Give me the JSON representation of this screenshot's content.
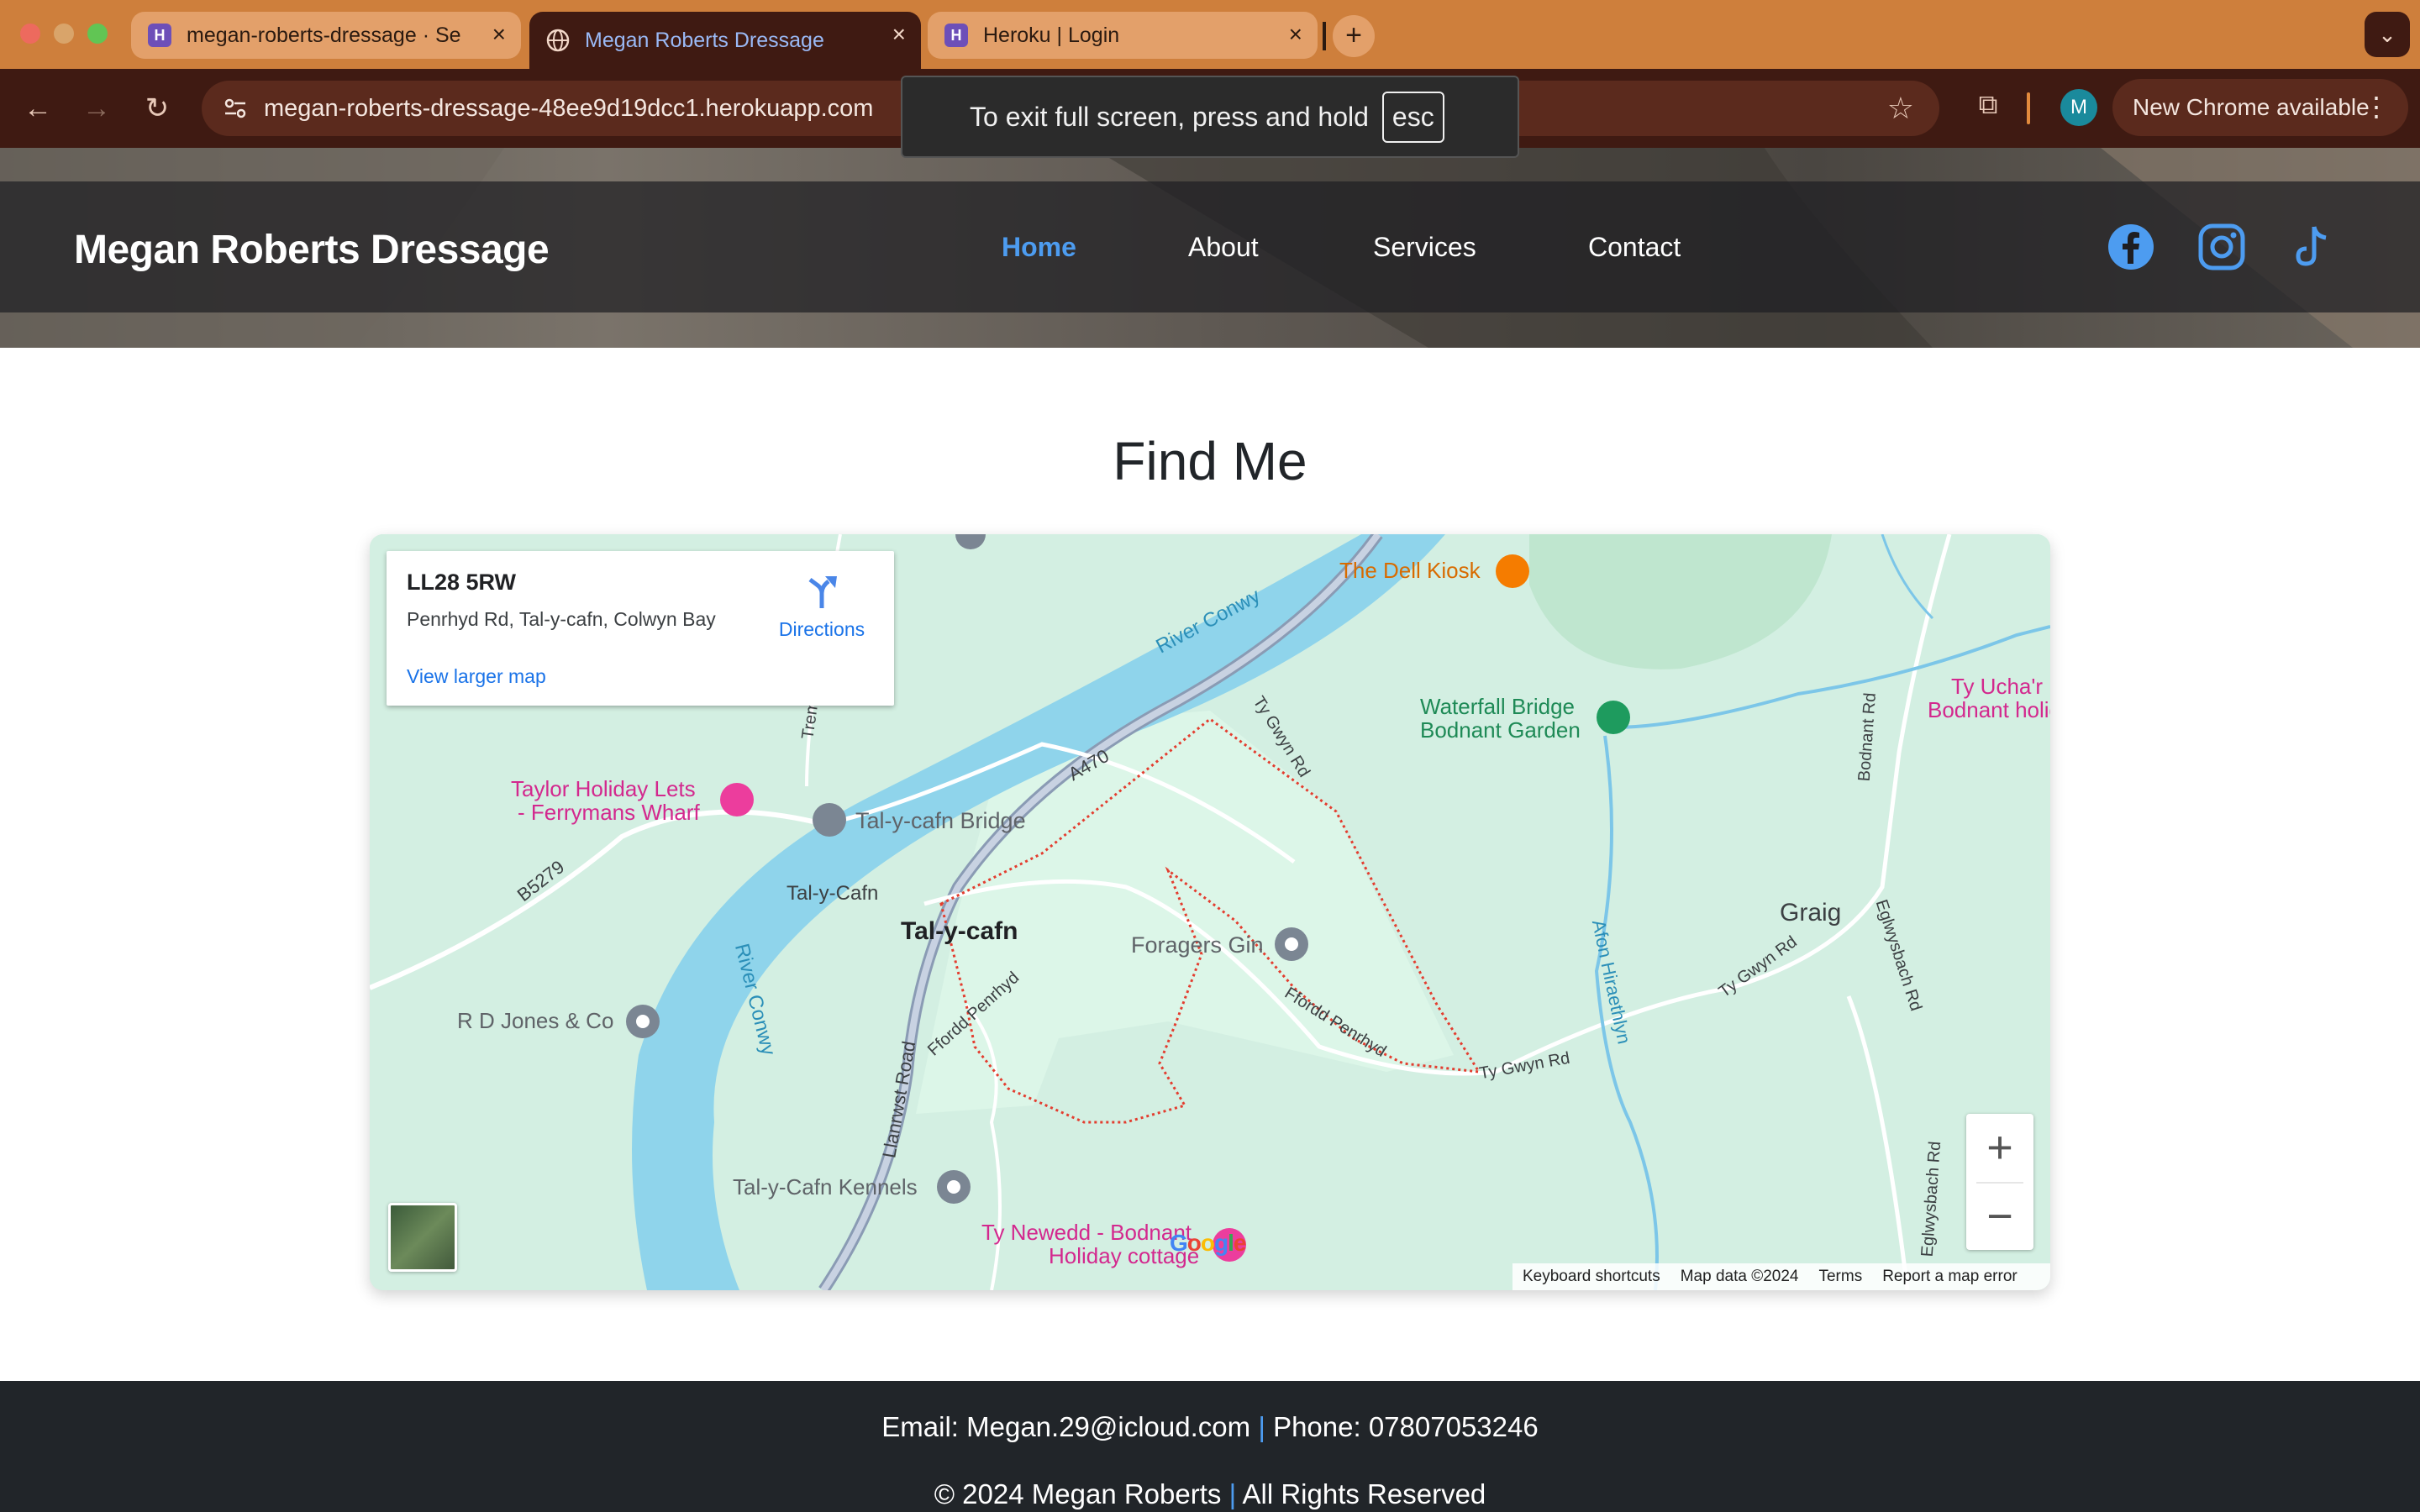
{
  "browser": {
    "tabs": [
      {
        "title": "megan-roberts-dressage · Se",
        "favicon": "heroku-icon"
      },
      {
        "title": "Megan Roberts Dressage",
        "favicon": "globe-icon"
      },
      {
        "title": "Heroku | Login",
        "favicon": "heroku-icon"
      }
    ],
    "url": "megan-roberts-dressage-48ee9d19dcc1.herokuapp.com",
    "profile_initial": "M",
    "update_label": "New Chrome available",
    "fullscreen_notice": "To exit full screen, press and hold",
    "fullscreen_key": "esc"
  },
  "site": {
    "brand": "Megan Roberts Dressage",
    "nav": [
      {
        "label": "Home",
        "active": true
      },
      {
        "label": "About",
        "active": false
      },
      {
        "label": "Services",
        "active": false
      },
      {
        "label": "Contact",
        "active": false
      }
    ],
    "social_icons": [
      "facebook-icon",
      "instagram-icon",
      "tiktok-icon"
    ],
    "section_title": "Find Me"
  },
  "map": {
    "card": {
      "postcode": "LL28 5RW",
      "address": "Penrhyd Rd, Tal-y-cafn, Colwyn Bay",
      "directions_label": "Directions",
      "larger_map_label": "View larger map"
    },
    "labels": {
      "river_conwy_1": "River Conwy",
      "river_conwy_2": "River Conwy",
      "a470": "A470",
      "b5279": "B5279",
      "ty_gwyn_rd_1": "Ty Gwyn Rd",
      "ty_gwyn_rd_2": "Ty Gwyn Rd",
      "ty_gwyn_rd_3": "Ty Gwyn Rd",
      "trefriw": "Tremofa",
      "dell_kiosk": "The Dell Kiosk",
      "waterfall_1": "Waterfall Bridge",
      "waterfall_2": "Bodnant Garden",
      "ty_ucha_1": "Ty Ucha'r",
      "ty_ucha_2": "Bodnant holiday",
      "bodnant_rd": "Bodnant Rd",
      "taylor_1": "Taylor Holiday Lets",
      "taylor_2": "- Ferrymans Wharf",
      "tal_bridge": "Tal-y-cafn Bridge",
      "tal_station": "Tal-y-Cafn",
      "tal_town": "Tal-y-cafn",
      "foragers": "Foragers Gin",
      "graig": "Graig",
      "eglwysbach_1": "Eglwysbach Rd",
      "eglwysbach_2": "Eglwysbach Rd",
      "afon": "Afon Hiraethlyn",
      "rd_jones": "R D Jones & Co",
      "ffordd_1": "Ffordd Penrhyd",
      "ffordd_2": "Ffordd Penrhyd",
      "llanrwst": "Llanrwst Road",
      "kennels": "Tal-y-Cafn Kennels",
      "ty_newedd_1": "Ty Newedd - Bodnant",
      "ty_newedd_2": "Holiday cottage"
    },
    "zoom_in": "+",
    "zoom_out": "−",
    "google": "Google",
    "attribution": [
      "Keyboard shortcuts",
      "Map data ©2024",
      "Terms",
      "Report a map error"
    ]
  },
  "footer": {
    "email": "Email: Megan.29@icloud.com",
    "phone": "Phone: 07807053246",
    "copyright": "© 2024 Megan Roberts",
    "rights": "All Rights Reserved",
    "separator": "|"
  }
}
